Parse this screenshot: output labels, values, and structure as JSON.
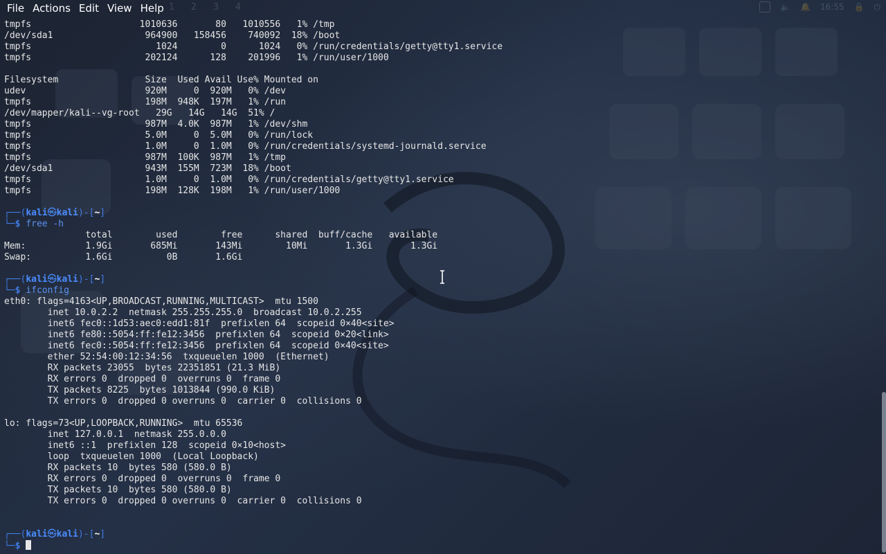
{
  "menu": {
    "file": "File",
    "actions": "Actions",
    "edit": "Edit",
    "view": "View",
    "help": "Help"
  },
  "workspaces": [
    "1",
    "2",
    "3",
    "4"
  ],
  "tray": {
    "clock": "16:55"
  },
  "prompt": {
    "user": "kali",
    "at": "㉿",
    "host": "kali",
    "dir": "~"
  },
  "df_raw_tail": [
    "tmpfs                    1010636       80   1010556   1% /tmp",
    "/dev/sda1                 964900   158456    740092  18% /boot",
    "tmpfs                       1024        0      1024   0% /run/credentials/getty@tty1.service",
    "tmpfs                     202124      128    201996   1% /run/user/1000"
  ],
  "df_h": [
    "Filesystem                Size  Used Avail Use% Mounted on",
    "udev                      920M     0  920M   0% /dev",
    "tmpfs                     198M  948K  197M   1% /run",
    "/dev/mapper/kali--vg-root   29G   14G   14G  51% /",
    "tmpfs                     987M  4.0K  987M   1% /dev/shm",
    "tmpfs                     5.0M     0  5.0M   0% /run/lock",
    "tmpfs                     1.0M     0  1.0M   0% /run/credentials/systemd-journald.service",
    "tmpfs                     987M  100K  987M   1% /tmp",
    "/dev/sda1                 943M  155M  723M  18% /boot",
    "tmpfs                     1.0M     0  1.0M   0% /run/credentials/getty@tty1.service",
    "tmpfs                     198M  128K  198M   1% /run/user/1000"
  ],
  "commands": {
    "free": "free -h",
    "ifconfig": "ifconfig"
  },
  "free_output": [
    "               total        used        free      shared  buff/cache   available",
    "Mem:           1.9Gi       685Mi       143Mi        10Mi       1.3Gi       1.3Gi",
    "Swap:          1.6Gi          0B       1.6Gi"
  ],
  "ifconfig_output": [
    "eth0: flags=4163<UP,BROADCAST,RUNNING,MULTICAST>  mtu 1500",
    "        inet 10.0.2.2  netmask 255.255.255.0  broadcast 10.0.2.255",
    "        inet6 fec0::1d53:aec0:edd1:81f  prefixlen 64  scopeid 0×40<site>",
    "        inet6 fe80::5054:ff:fe12:3456  prefixlen 64  scopeid 0×20<link>",
    "        inet6 fec0::5054:ff:fe12:3456  prefixlen 64  scopeid 0×40<site>",
    "        ether 52:54:00:12:34:56  txqueuelen 1000  (Ethernet)",
    "        RX packets 23055  bytes 22351851 (21.3 MiB)",
    "        RX errors 0  dropped 0  overruns 0  frame 0",
    "        TX packets 8225  bytes 1013844 (990.0 KiB)",
    "        TX errors 0  dropped 0 overruns 0  carrier 0  collisions 0",
    "",
    "lo: flags=73<UP,LOOPBACK,RUNNING>  mtu 65536",
    "        inet 127.0.0.1  netmask 255.0.0.0",
    "        inet6 ::1  prefixlen 128  scopeid 0×10<host>",
    "        loop  txqueuelen 1000  (Local Loopback)",
    "        RX packets 10  bytes 580 (580.0 B)",
    "        RX errors 0  dropped 0  overruns 0  frame 0",
    "        TX packets 10  bytes 580 (580.0 B)",
    "        TX errors 0  dropped 0 overruns 0  carrier 0  collisions 0"
  ],
  "colors": {
    "background": "#1f2736",
    "prompt_frame": "#3f7be6",
    "prompt_user": "#4a8cff",
    "command": "#5b92f0",
    "text": "#e6e6e6"
  }
}
